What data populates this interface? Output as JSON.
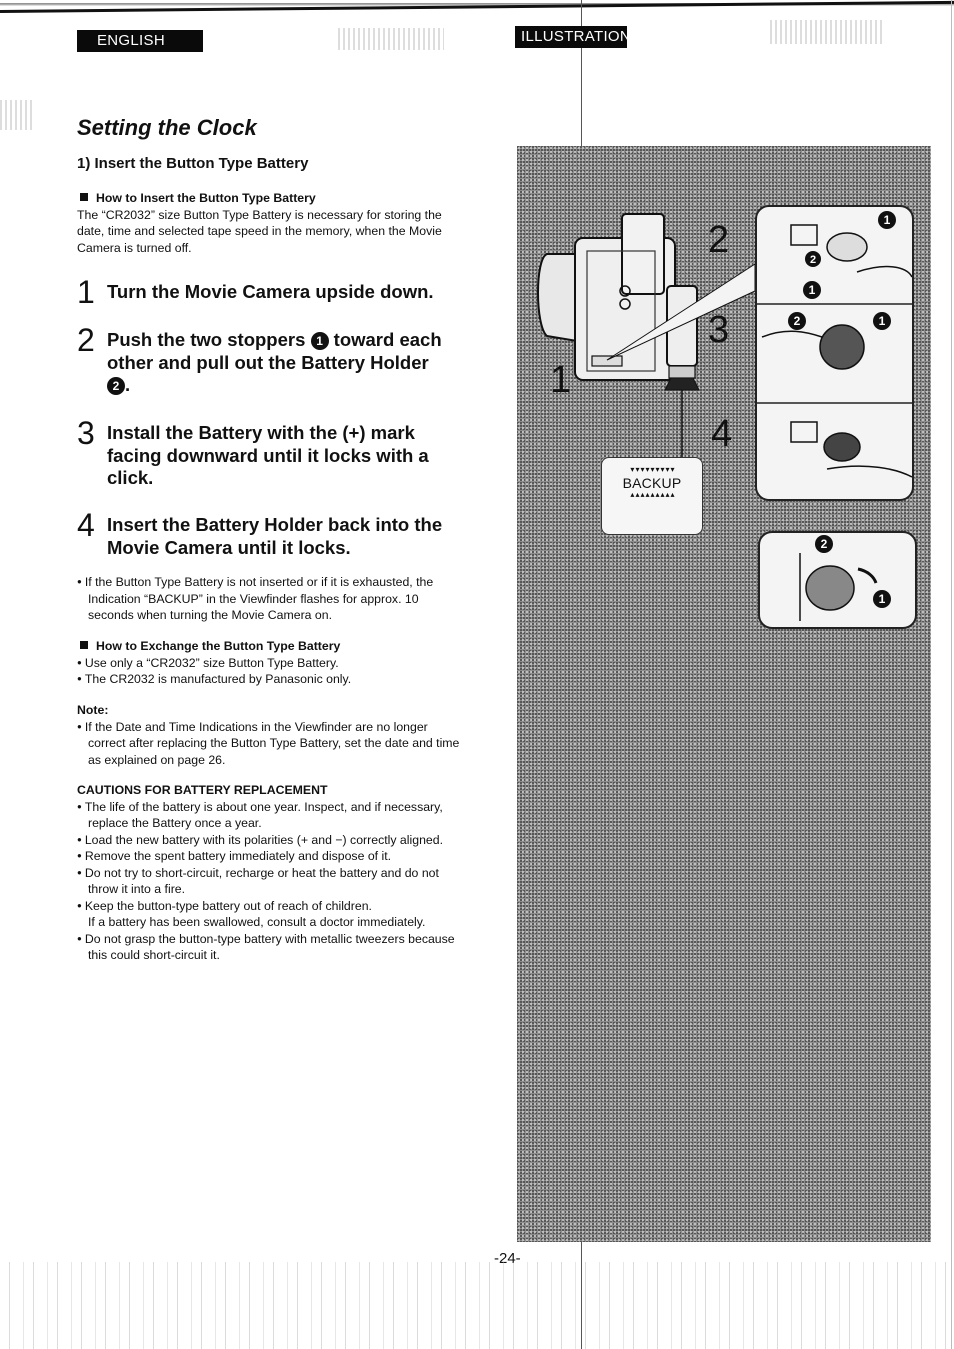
{
  "header": {
    "language_tag": "ENGLISH",
    "illustration_tag": "ILLUSTRATION"
  },
  "title": "Setting the Clock",
  "section": "1)  Insert the Button Type Battery",
  "how_to_insert": {
    "heading": "How to Insert the Button Type Battery",
    "body": "The “CR2032” size Button Type Battery is necessary for storing the date, time and selected tape speed in the memory, when the Movie Camera is turned off."
  },
  "steps": [
    {
      "number": "1",
      "parts": [
        "Turn the Movie Camera upside down."
      ]
    },
    {
      "number": "2",
      "parts": [
        "Push the two stoppers ",
        "❶",
        " toward each other and pull out the Battery Holder ",
        "❷",
        "."
      ]
    },
    {
      "number": "3",
      "parts": [
        "Install the Battery with the (+) mark facing downward until it locks with a click."
      ]
    },
    {
      "number": "4",
      "parts": [
        "Insert the Battery Holder back into the Movie Camera until it locks."
      ]
    }
  ],
  "backup_note": "If the Button Type Battery is not inserted or if it is exhausted, the Indication “BACKUP” in the Viewfinder flashes for approx. 10 seconds when turning the Movie Camera on.",
  "how_to_exchange": {
    "heading": "How to Exchange the Button Type Battery",
    "bullets": [
      "Use only a “CR2032” size Button Type Battery.",
      "The CR2032 is manufactured by Panasonic only."
    ]
  },
  "note": {
    "heading": "Note:",
    "bullets": [
      "If the Date and Time Indications in the Viewfinder are no longer correct after replacing the Button Type Battery, set the date and time as explained on page 26."
    ]
  },
  "cautions": {
    "heading": "CAUTIONS FOR BATTERY REPLACEMENT",
    "items": [
      {
        "text": "The life of the battery is about one year. Inspect, and if necessary, replace the Battery once a year."
      },
      {
        "text": "Load the new battery with its polarities (+ and −) correctly aligned."
      },
      {
        "text": "Remove the spent battery immediately and dispose of it."
      },
      {
        "text": "Do not try to short-circuit, recharge or heat the battery and do not throw it into a fire."
      },
      {
        "text": "Keep the button-type battery out of reach of children.",
        "continuation": "If a battery has been swallowed, consult a doctor immediately."
      },
      {
        "text": "Do not grasp the button-type battery with metallic tweezers because this could short-circuit it."
      }
    ]
  },
  "illustration": {
    "step_labels": [
      "1",
      "2",
      "3",
      "4"
    ],
    "viewfinder_indication": "BACKUP",
    "callouts": [
      "❶",
      "❷"
    ]
  },
  "page_number": "-24-"
}
